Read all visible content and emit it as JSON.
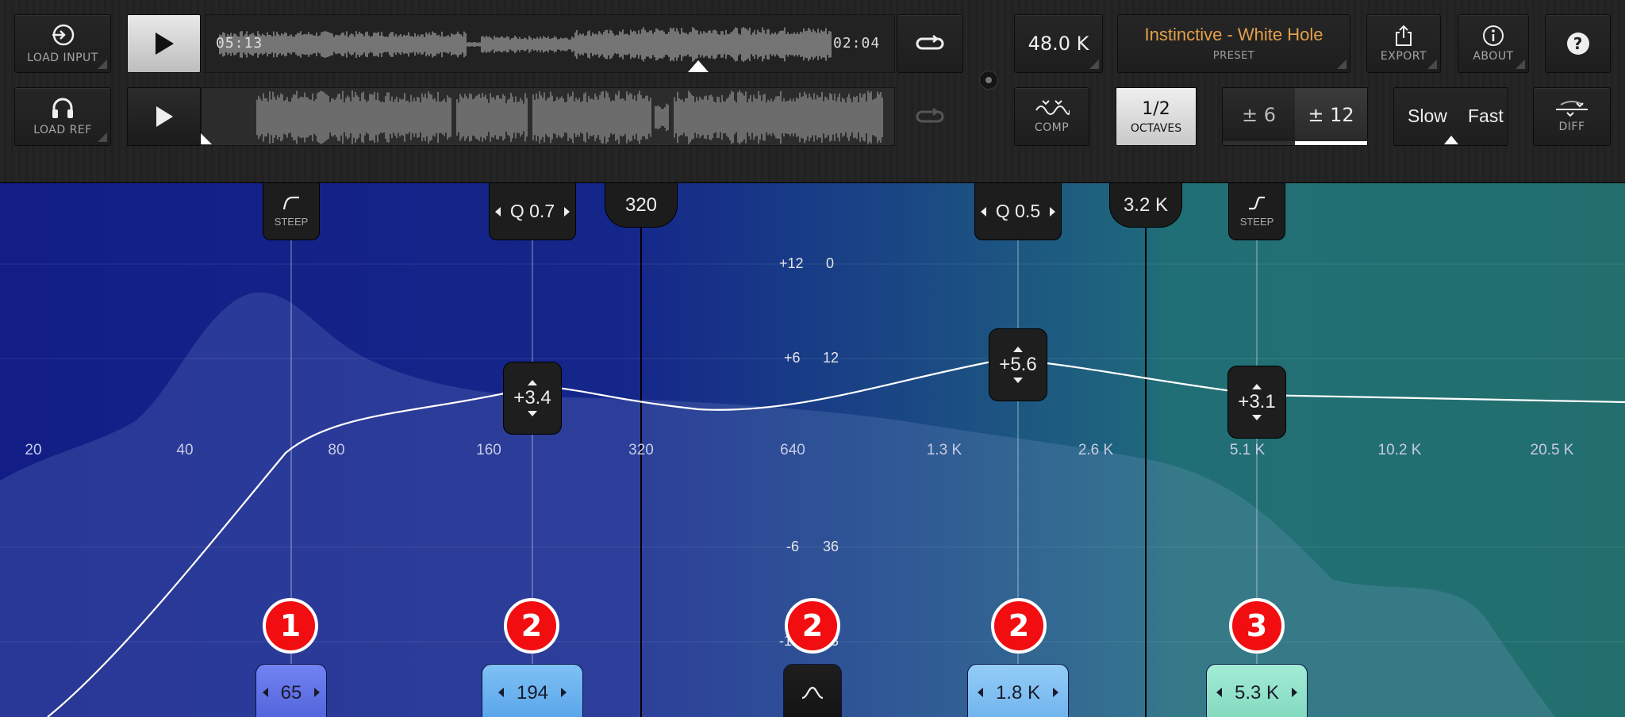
{
  "transport": {
    "input": {
      "button_label": "LOAD INPUT",
      "time_elapsed": "05:13",
      "time_remaining": "02:04"
    },
    "reference": {
      "button_label": "LOAD REF"
    }
  },
  "toolbar": {
    "sample_rate": "48.0 K",
    "preset_name": "Instinctive - White Hole",
    "preset_label": "PRESET",
    "export_label": "EXPORT",
    "about_label": "ABOUT",
    "help_glyph": "?",
    "comp_label": "COMP",
    "octaves_value": "1/2",
    "octaves_label": "OCTAVES",
    "range_options": [
      "± 6",
      "± 12"
    ],
    "range_selected": "± 12",
    "speed_options": [
      "Slow",
      "Fast"
    ],
    "diff_label": "DIFF"
  },
  "eq": {
    "crossover_bubbles": [
      "320",
      "3.2 K"
    ],
    "freq_axis": [
      "20",
      "40",
      "80",
      "160",
      "320",
      "640",
      "1.3 K",
      "2.6 K",
      "5.1 K",
      "10.2 K",
      "20.5 K"
    ],
    "db_left": [
      "+12",
      "+6",
      "-6",
      "-12"
    ],
    "db_right": [
      "0",
      "12",
      "36",
      "48"
    ],
    "bands": [
      {
        "badge": "1",
        "top_label": "STEEP",
        "top_icon": "highpass-curve-icon",
        "gain": "",
        "freq": "65",
        "color": "#5d6fe0"
      },
      {
        "badge": "2",
        "top_label": "Q 0.7",
        "gain": "+3.4",
        "freq": "194",
        "color": "#5fa8ec"
      },
      {
        "badge": "2",
        "top_label": "",
        "gain": "",
        "freq": "",
        "color": "#151515",
        "icon": "bell-shape-icon"
      },
      {
        "badge": "2",
        "top_label": "Q 0.5",
        "gain": "+5.6",
        "freq": "1.8 K",
        "color": "#79b9ee"
      },
      {
        "badge": "3",
        "top_label": "STEEP",
        "top_icon": "highshelf-curve-icon",
        "gain": "+3.1",
        "freq": "5.3 K",
        "color": "#86dbc2"
      }
    ]
  },
  "colors": {
    "preset_text": "#e3a04a",
    "badge_red": "#f20d10",
    "eq_left": "#121e86",
    "eq_right": "#236f6e"
  }
}
